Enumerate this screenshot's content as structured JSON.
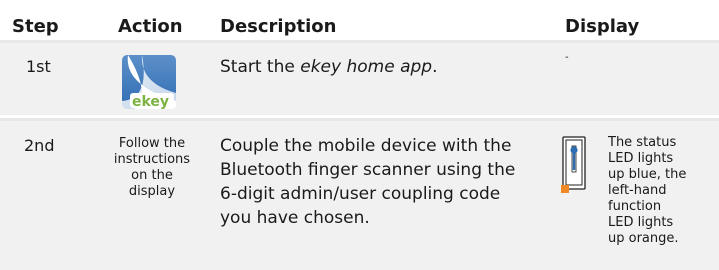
{
  "table": {
    "headers": {
      "step": "Step",
      "action": "Action",
      "description": "Description",
      "display": "Display"
    },
    "rows": [
      {
        "step": "1st",
        "action_icon": "ekey-app-icon",
        "action_logo_text": "ekey",
        "description_before": "Start the ",
        "description_italic": "ekey home app",
        "description_after": ".",
        "display": "-"
      },
      {
        "step": "2nd",
        "action_lines": [
          "Follow the",
          "instructions",
          "on the",
          "display"
        ],
        "description_lines": [
          "Couple the mobile device with the",
          "Bluetooth finger scanner using the",
          "6-digit admin/user coupling code",
          "you have chosen."
        ],
        "display_icon": "finger-scanner-icon",
        "display_lines": [
          "The status",
          "LED lights",
          "up blue, the",
          "left-hand",
          "function",
          "LED lights",
          "up orange."
        ]
      }
    ]
  },
  "colors": {
    "row_background": "#f1f1f1",
    "icon_blue": "#2f6db3",
    "led_orange": "#f08a24",
    "ekey_green": "#7cb342"
  }
}
